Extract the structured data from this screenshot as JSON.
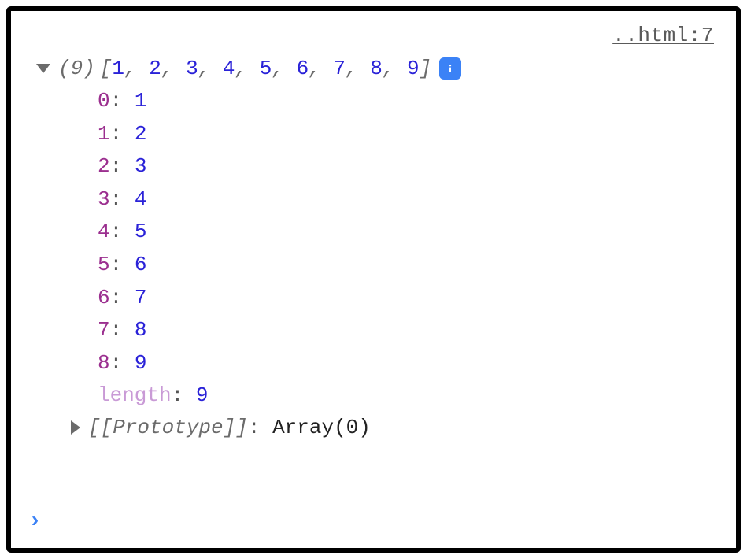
{
  "source": {
    "link": "..html:7"
  },
  "array": {
    "length_display": "(9)",
    "preview_open": "[",
    "preview_close": "]",
    "values": [
      "1",
      "2",
      "3",
      "4",
      "5",
      "6",
      "7",
      "8",
      "9"
    ],
    "sep": ", "
  },
  "info_icon": "i",
  "props": {
    "entries": [
      {
        "key": "0",
        "value": "1"
      },
      {
        "key": "1",
        "value": "2"
      },
      {
        "key": "2",
        "value": "3"
      },
      {
        "key": "3",
        "value": "4"
      },
      {
        "key": "4",
        "value": "5"
      },
      {
        "key": "5",
        "value": "6"
      },
      {
        "key": "6",
        "value": "7"
      },
      {
        "key": "7",
        "value": "8"
      },
      {
        "key": "8",
        "value": "9"
      }
    ],
    "length_key": "length",
    "length_value": "9"
  },
  "prototype": {
    "label": "[[Prototype]]",
    "value": "Array(0)"
  },
  "prompt": "›"
}
